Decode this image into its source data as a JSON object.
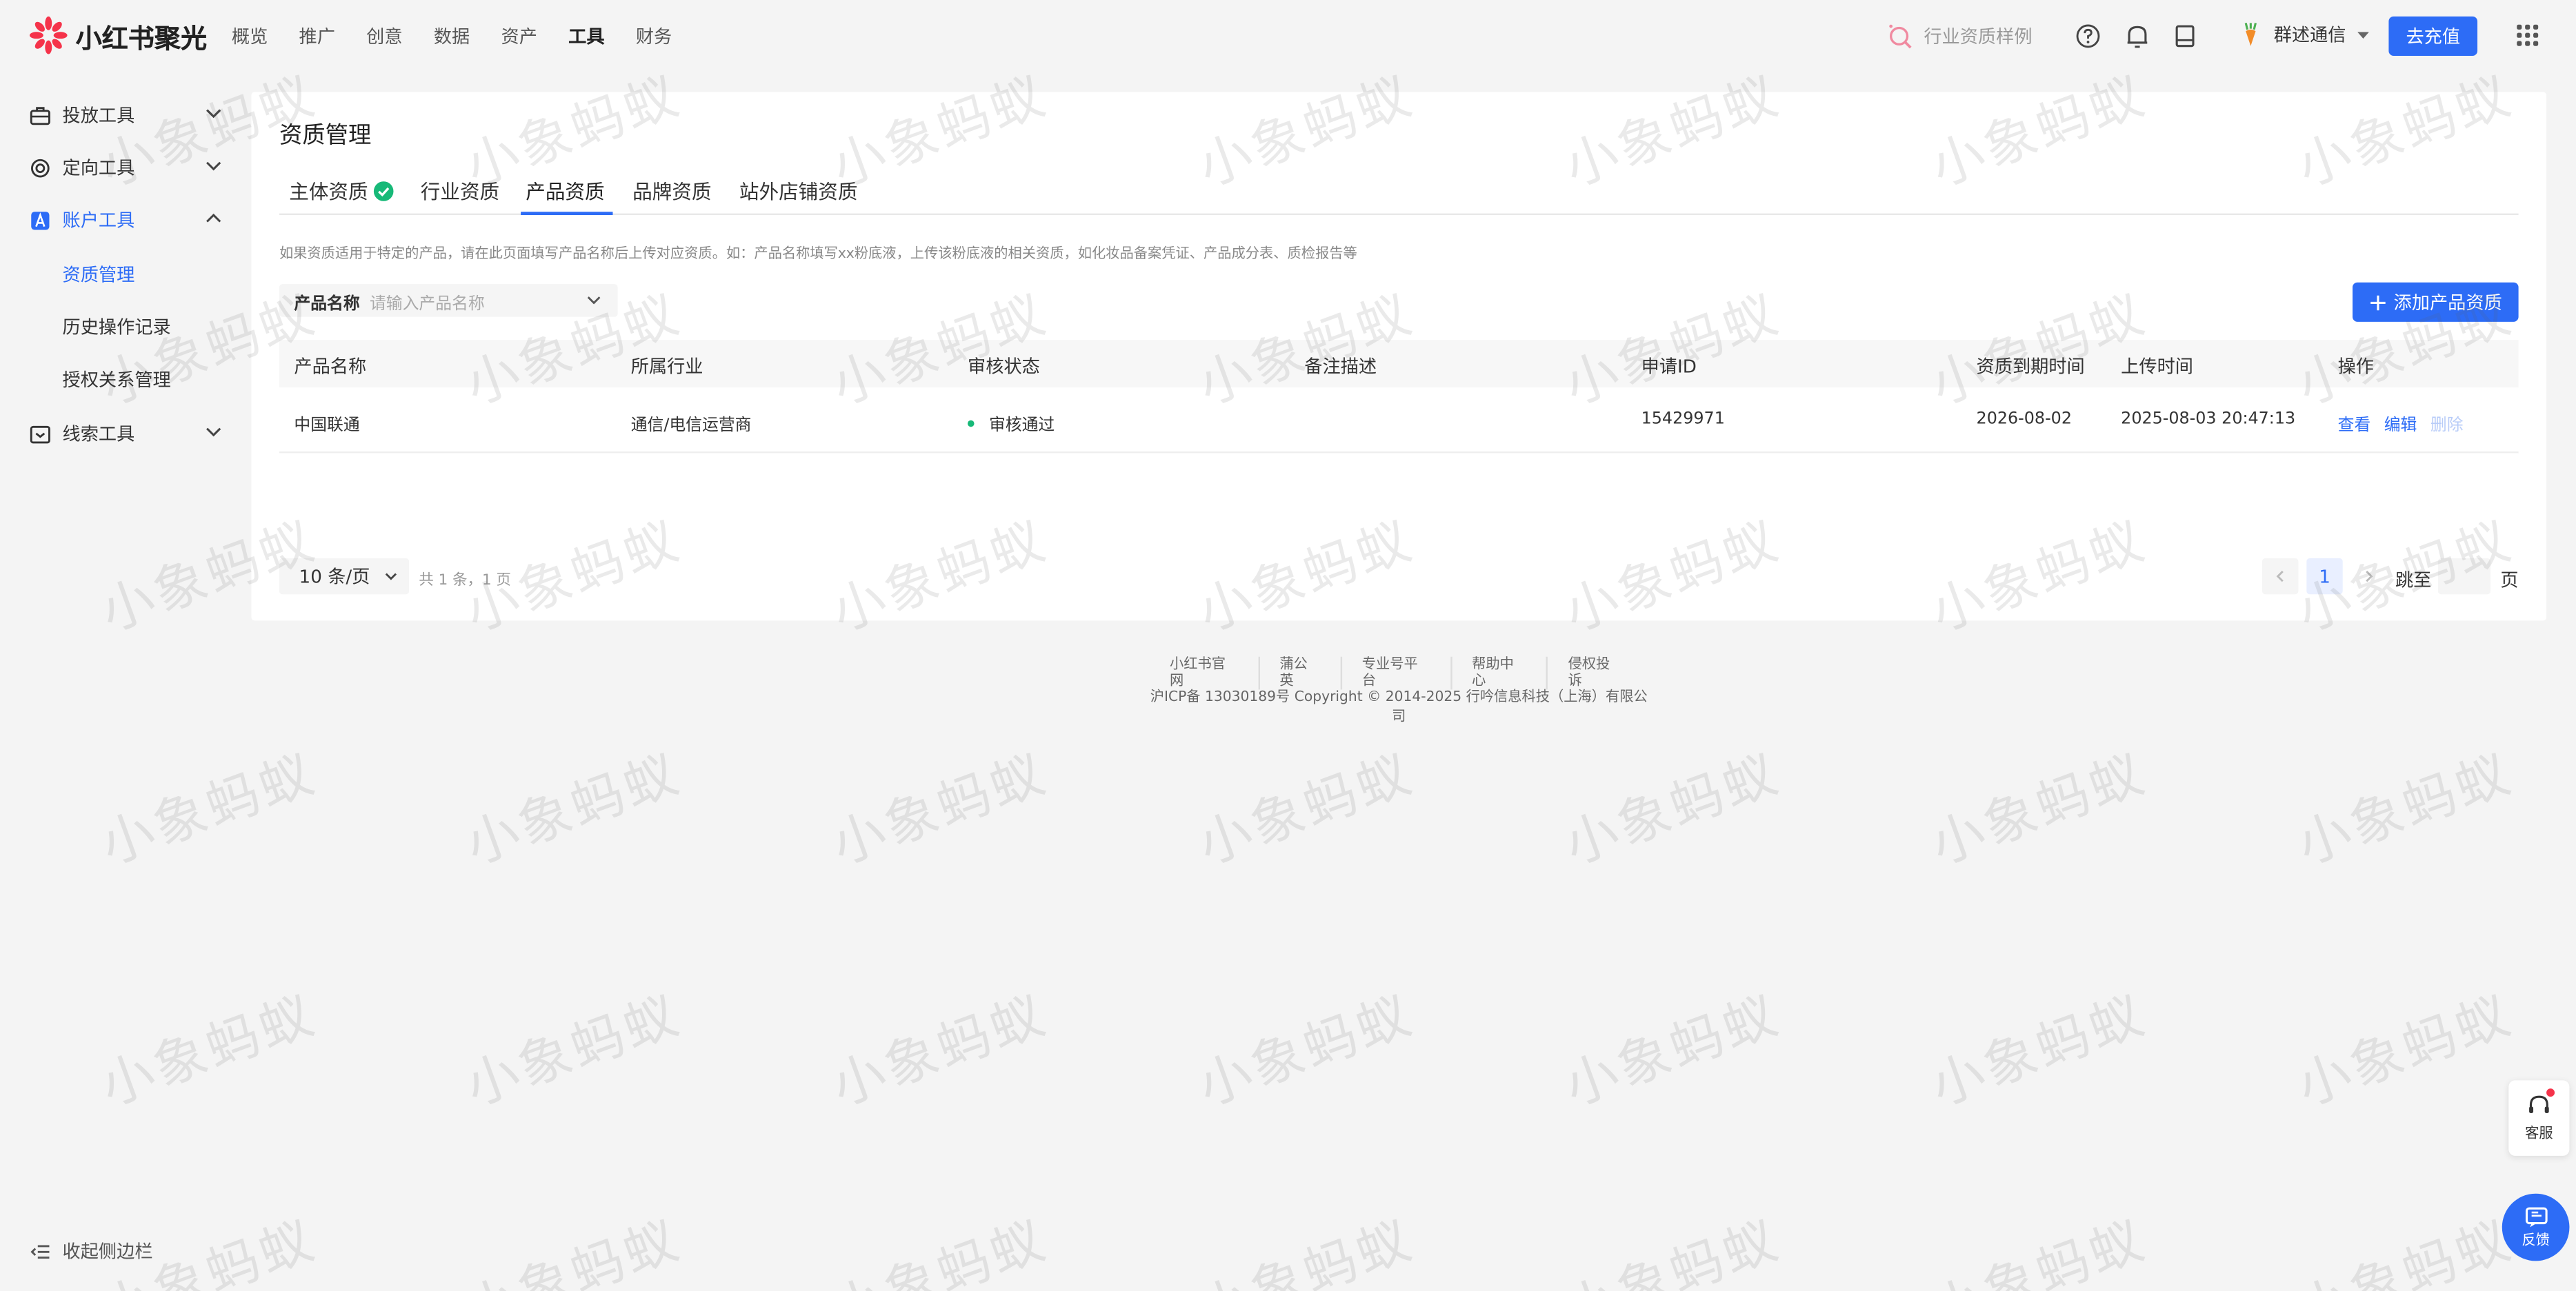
{
  "header": {
    "logo_text": "小红书聚光",
    "nav": [
      {
        "label": "概览",
        "active": false
      },
      {
        "label": "推广",
        "active": false
      },
      {
        "label": "创意",
        "active": false
      },
      {
        "label": "数据",
        "active": false
      },
      {
        "label": "资产",
        "active": false
      },
      {
        "label": "工具",
        "active": true
      },
      {
        "label": "财务",
        "active": false
      }
    ],
    "search_label": "行业资质样例",
    "account_name": "群述通信",
    "charge_label": "去充值"
  },
  "sidebar": {
    "groups": [
      {
        "label": "投放工具",
        "expanded": false
      },
      {
        "label": "定向工具",
        "expanded": false
      },
      {
        "label": "账户工具",
        "expanded": true,
        "items": [
          "资质管理",
          "历史操作记录",
          "授权关系管理"
        ]
      },
      {
        "label": "线索工具",
        "expanded": false
      }
    ],
    "active_item": "资质管理",
    "collapse_label": "收起侧边栏"
  },
  "main": {
    "title": "资质管理",
    "tabs": [
      {
        "label": "主体资质",
        "verified": true
      },
      {
        "label": "行业资质"
      },
      {
        "label": "产品资质",
        "active": true
      },
      {
        "label": "品牌资质"
      },
      {
        "label": "站外店铺资质"
      }
    ],
    "hint": "如果资质适用于特定的产品，请在此页面填写产品名称后上传对应资质。如：产品名称填写xx粉底液，上传该粉底液的相关资质，如化妆品备案凭证、产品成分表、质检报告等",
    "filter": {
      "label": "产品名称",
      "placeholder": "请输入产品名称"
    },
    "add_button": "添加产品资质",
    "table": {
      "columns": [
        "产品名称",
        "所属行业",
        "审核状态",
        "备注描述",
        "申请ID",
        "资质到期时间",
        "上传时间",
        "操作"
      ],
      "rows": [
        {
          "product": "中国联通",
          "industry": "通信/电信运营商",
          "status": "审核通过",
          "remark": "",
          "apply_id": "15429971",
          "expire": "2026-08-02",
          "upload_time": "2025-08-03 20:47:13",
          "actions": [
            "查看",
            "编辑",
            "删除"
          ]
        }
      ]
    },
    "pagination": {
      "page_size": "10 条/页",
      "total": "共 1 条，1 页",
      "current_page": "1",
      "jump_label": "跳至",
      "page_word": "页"
    }
  },
  "footer": {
    "links": [
      "小红书官网",
      "蒲公英",
      "专业号平台",
      "帮助中心",
      "侵权投诉"
    ],
    "copyright": "沪ICP备 13030189号 Copyright © 2014-2025 行吟信息科技（上海）有限公司"
  },
  "floating": {
    "customer_service": "客服",
    "feedback": "反馈"
  },
  "watermark_text": "小象蚂蚁",
  "colors": {
    "accent": "#2d6cf6",
    "success": "#17b978",
    "brand_red": "#f5334a"
  }
}
